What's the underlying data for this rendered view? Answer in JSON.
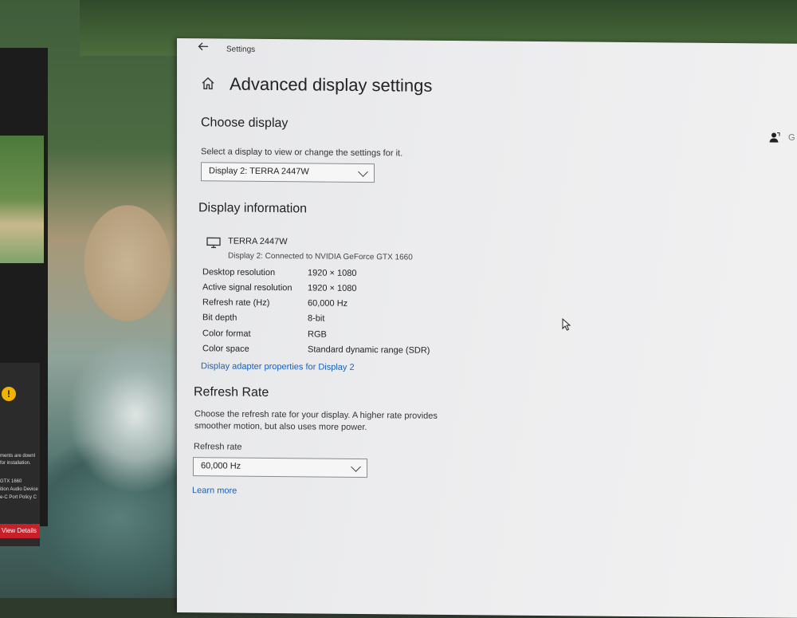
{
  "window": {
    "title": "Settings",
    "page_title": "Advanced display settings",
    "partial_right_text": "G"
  },
  "choose_display": {
    "heading": "Choose display",
    "description": "Select a display to view or change the settings for it.",
    "selected": "Display 2: TERRA 2447W"
  },
  "display_info": {
    "heading": "Display information",
    "monitor_name": "TERRA 2447W",
    "monitor_sub": "Display 2: Connected to NVIDIA GeForce GTX 1660",
    "rows": [
      {
        "label": "Desktop resolution",
        "value": "1920 × 1080"
      },
      {
        "label": "Active signal resolution",
        "value": "1920 × 1080"
      },
      {
        "label": "Refresh rate (Hz)",
        "value": "60,000 Hz"
      },
      {
        "label": "Bit depth",
        "value": "8-bit"
      },
      {
        "label": "Color format",
        "value": "RGB"
      },
      {
        "label": "Color space",
        "value": "Standard dynamic range (SDR)"
      }
    ],
    "adapter_link": "Display adapter properties for Display 2"
  },
  "refresh": {
    "heading": "Refresh Rate",
    "description_line1": "Choose the refresh rate for your display. A higher rate provides",
    "description_line2": "smoother motion, but also uses more power.",
    "label": "Refresh rate",
    "selected": "60,000 Hz",
    "learn_more": "Learn more"
  },
  "left_monitor": {
    "warn_glyph": "!",
    "line1": "ments are downl",
    "line2": "for installation.",
    "line3": "GTX 1660",
    "line4": "ition Audio Device",
    "line5": "e-C Port Policy C",
    "button": "View Details"
  },
  "colors": {
    "link": "#1a5fb4",
    "window_bg": "#ececee",
    "warning": "#f0b400",
    "alert_button": "#c8202a"
  }
}
